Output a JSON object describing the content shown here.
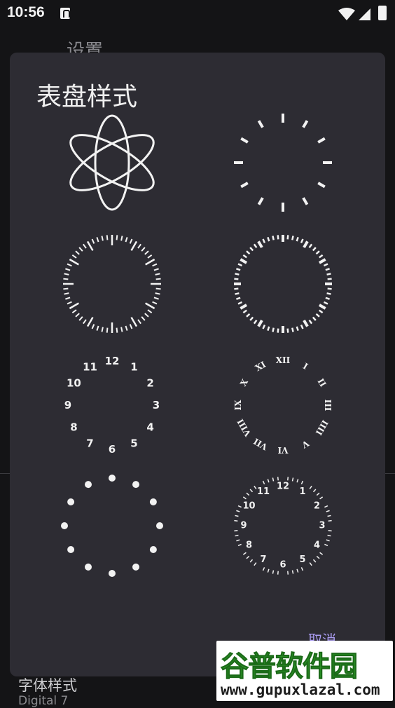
{
  "status_bar": {
    "time": "10:56"
  },
  "background": {
    "title": "设置",
    "font_label": "字体样式",
    "font_value": "Digital 7"
  },
  "dialog": {
    "title": "表盘样式",
    "faces": [
      {
        "name": "atom"
      },
      {
        "name": "twelve-bars"
      },
      {
        "name": "minute-ticks"
      },
      {
        "name": "tapered-ticks"
      },
      {
        "name": "arabic-numerals",
        "numerals": [
          "12",
          "1",
          "2",
          "3",
          "4",
          "5",
          "6",
          "7",
          "8",
          "9",
          "10",
          "11"
        ]
      },
      {
        "name": "roman-numerals",
        "numerals": [
          "XII",
          "I",
          "II",
          "III",
          "IIII",
          "V",
          "VI",
          "VII",
          "VIII",
          "IX",
          "X",
          "XI"
        ]
      },
      {
        "name": "dots"
      },
      {
        "name": "numerals-with-ticks",
        "numerals": [
          "12",
          "1",
          "2",
          "3",
          "4",
          "5",
          "6",
          "7",
          "8",
          "9",
          "10",
          "11"
        ]
      }
    ],
    "cancel_label": "取消"
  },
  "watermark": {
    "name": "谷普软件园",
    "url": "www.gupuxlazal.com"
  },
  "colors": {
    "dialog_bg": "#2d2c33",
    "accent": "#a99bf0",
    "face_stroke": "#f2f2f2"
  }
}
